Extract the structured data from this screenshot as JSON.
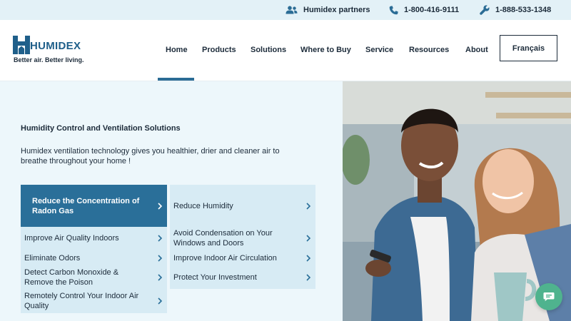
{
  "topbar": {
    "partners": "Humidex partners",
    "phone1": "1-800-416-9111",
    "phone2": "1-888-533-1348"
  },
  "logo": {
    "wordmark": "HUMIDEX",
    "tagline": "Better air. Better living."
  },
  "nav": {
    "items": [
      "Home",
      "Products",
      "Solutions",
      "Where to Buy",
      "Service",
      "Resources",
      "About"
    ],
    "active": "Home",
    "language_button": "Français"
  },
  "hero": {
    "heading": "Humidity Control and Ventilation Solutions",
    "description": "Humidex ventilation technology gives you healthier, drier and cleaner air to breathe throughout your home !",
    "solutions_left": [
      "Reduce the Concentration of Radon Gas",
      "Improve Air Quality Indoors",
      "Eliminate Odors",
      "Detect Carbon Monoxide & Remove the Poison",
      "Remotely Control Your Indoor Air Quality"
    ],
    "solutions_right": [
      "Reduce Humidity",
      "Avoid Condensation on Your Windows and Doors",
      "Improve Indoor Air Circulation",
      "Protect Your Investment"
    ],
    "active_solution": "Reduce the Concentration of Radon Gas"
  },
  "colors": {
    "brand_blue": "#2a6f99",
    "tile_bg": "#d7ebf4",
    "hero_bg": "#edf7fb",
    "topbar_bg": "#e3f1f7",
    "chat_green": "#4fb38e"
  },
  "icons": {
    "partners": "users-icon",
    "phone": "phone-icon",
    "service": "wrench-icon",
    "chat": "chat-icon",
    "tile_arrow": "chevron-right-icon"
  }
}
